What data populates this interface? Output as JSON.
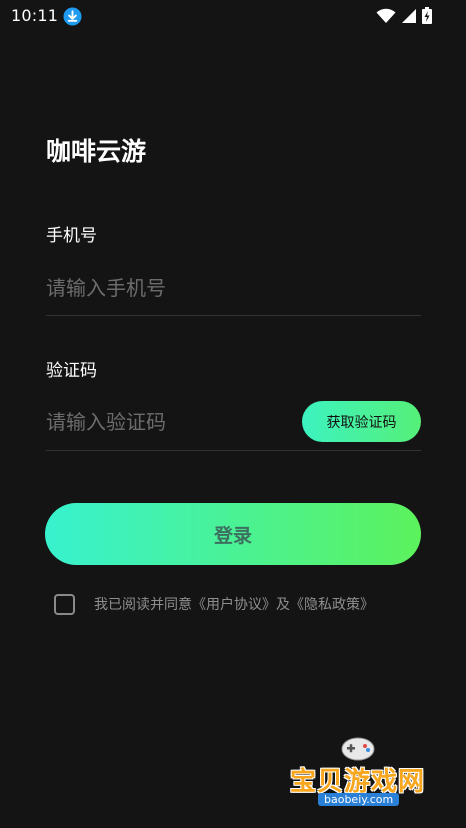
{
  "status_bar": {
    "time": "10:11",
    "icons": [
      "download-icon",
      "wifi-icon",
      "signal-icon",
      "battery-charging-icon"
    ]
  },
  "app": {
    "title": "咖啡云游"
  },
  "phone": {
    "label": "手机号",
    "placeholder": "请输入手机号",
    "value": ""
  },
  "code": {
    "label": "验证码",
    "placeholder": "请输入验证码",
    "value": "",
    "get_code_label": "获取验证码"
  },
  "login": {
    "label": "登录"
  },
  "agreement": {
    "checked": false,
    "text": "我已阅读并同意《用户协议》及《隐私政策》"
  },
  "watermark": {
    "text": "宝贝游戏网",
    "url": "baobeiy.com"
  },
  "colors": {
    "background": "#141414",
    "accent_start": "#38f2cf",
    "accent_end": "#5cf25c"
  }
}
